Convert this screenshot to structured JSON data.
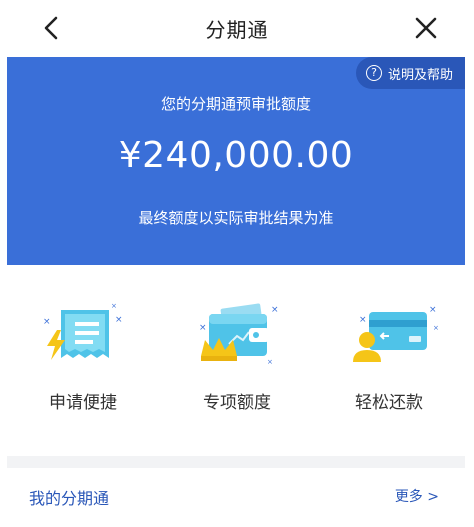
{
  "navbar": {
    "title": "分期通",
    "back_icon": "chevron-left-icon",
    "close_icon": "close-icon"
  },
  "banner": {
    "help_label": "说明及帮助",
    "help_icon_glyph": "?",
    "subtitle": "您的分期通预审批额度",
    "amount": "¥240,000.00",
    "note": "最终额度以实际审批结果为准",
    "background_color": "#3a6fd8"
  },
  "features": [
    {
      "label": "申请便捷",
      "icon": "receipt-lightning-icon"
    },
    {
      "label": "专项额度",
      "icon": "wallet-crown-icon"
    },
    {
      "label": "轻松还款",
      "icon": "card-user-icon"
    }
  ],
  "section": {
    "title": "我的分期通",
    "more_label": "更多 >"
  },
  "colors": {
    "accent": "#2a57b8",
    "icon_cyan": "#4fc3e8",
    "icon_yellow": "#f5c518"
  }
}
